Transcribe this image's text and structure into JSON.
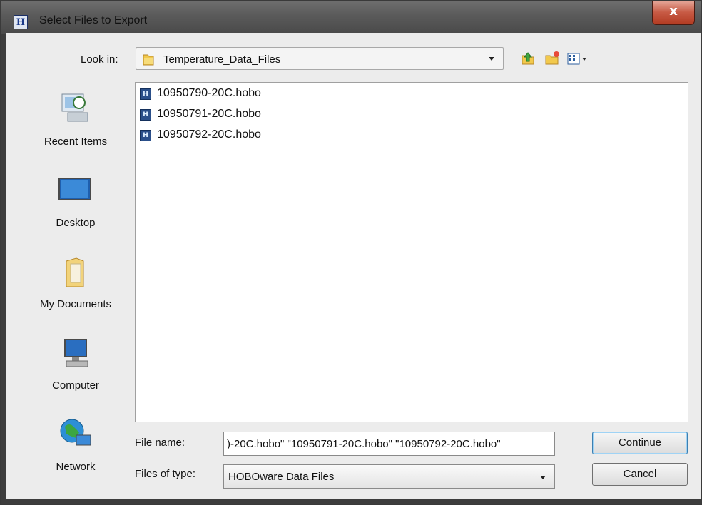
{
  "window": {
    "title": "Select Files to Export",
    "app_icon_letter": "H",
    "close_glyph": "x"
  },
  "look_in": {
    "label": "Look in:",
    "value": "Temperature_Data_Files"
  },
  "toolbar_icons": [
    "up-one-level-icon",
    "new-folder-icon",
    "view-menu-icon"
  ],
  "places": [
    {
      "label": "Recent Items",
      "icon": "recent-items-icon"
    },
    {
      "label": "Desktop",
      "icon": "desktop-icon"
    },
    {
      "label": "My Documents",
      "icon": "my-documents-icon"
    },
    {
      "label": "Computer",
      "icon": "computer-icon"
    },
    {
      "label": "Network",
      "icon": "network-icon"
    }
  ],
  "files": [
    {
      "name": "10950790-20C.hobo"
    },
    {
      "name": "10950791-20C.hobo"
    },
    {
      "name": "10950792-20C.hobo"
    }
  ],
  "file_icon_text": "H",
  "file_name": {
    "label": "File name:",
    "value": ")-20C.hobo\" \"10950791-20C.hobo\" \"10950792-20C.hobo\""
  },
  "file_type": {
    "label": "Files of type:",
    "value": "HOBOware Data Files"
  },
  "buttons": {
    "continue": "Continue",
    "cancel": "Cancel"
  }
}
